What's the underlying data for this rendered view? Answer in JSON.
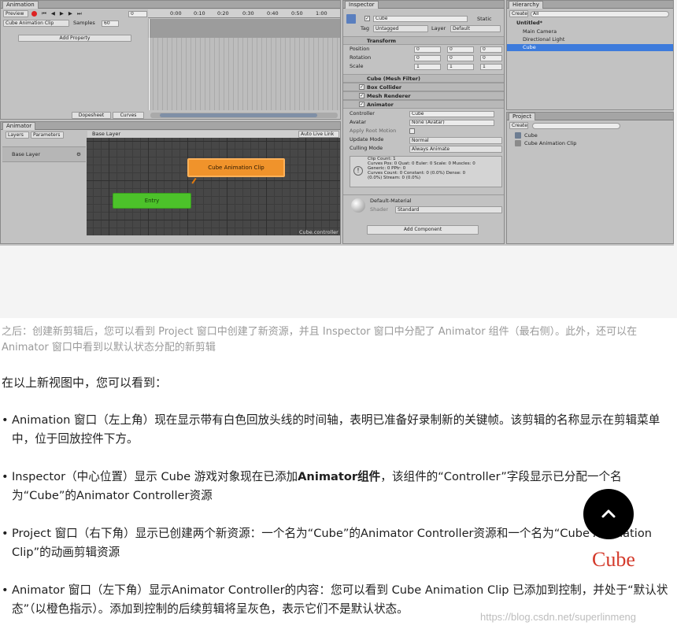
{
  "editor": {
    "animation": {
      "tab": "Animation",
      "preview": "Preview",
      "clip": "Cube Animation Clip",
      "samples_label": "Samples",
      "samples_value": "60",
      "frame_value": "0",
      "add_property": "Add Property",
      "times": [
        "0:00",
        "0:10",
        "0:20",
        "0:30",
        "0:40",
        "0:50",
        "1:00"
      ],
      "bottom_tabs": [
        "Dopesheet",
        "Curves"
      ]
    },
    "animator": {
      "tab": "Animator",
      "tabs": [
        "Layers",
        "Parameters"
      ],
      "layer": "Base Layer",
      "breadcrumb": "Base Layer",
      "auto_live": "Auto Live Link",
      "state_orange": "Cube Animation Clip",
      "state_green": "Entry",
      "footer": "Cube.controller"
    },
    "inspector": {
      "tab": "Inspector",
      "object_name": "Cube",
      "static": "Static",
      "tag_label": "Tag",
      "tag_value": "Untagged",
      "layer_label": "Layer",
      "layer_value": "Default",
      "transform": "Transform",
      "rows": [
        {
          "label": "Position",
          "x": "0",
          "y": "0",
          "z": "0"
        },
        {
          "label": "Rotation",
          "x": "0",
          "y": "0",
          "z": "0"
        },
        {
          "label": "Scale",
          "x": "1",
          "y": "1",
          "z": "1"
        }
      ],
      "components": [
        "Cube (Mesh Filter)",
        "Box Collider",
        "Mesh Renderer",
        "Animator"
      ],
      "animator_rows": [
        {
          "label": "Controller",
          "value": "Cube"
        },
        {
          "label": "Avatar",
          "value": "None (Avatar)"
        },
        {
          "label": "Apply Root Motion",
          "value": ""
        },
        {
          "label": "Update Mode",
          "value": "Normal"
        },
        {
          "label": "Culling Mode",
          "value": "Always Animate"
        }
      ],
      "info": [
        "Clip Count: 1",
        "Curves Pos: 0 Quat: 0 Euler: 0 Scale: 0 Muscles: 0",
        "Generic: 0 PPtr: 0",
        "Curves Count: 0 Constant: 0 (0.0%) Dense: 0",
        "(0.0%) Stream: 0 (0.0%)"
      ],
      "material": "Default-Material",
      "shader_label": "Shader",
      "shader_value": "Standard",
      "add_component": "Add Component"
    },
    "hierarchy": {
      "tab": "Hierarchy",
      "create": "Create",
      "search": "All",
      "scene": "Untitled*",
      "items": [
        "Main Camera",
        "Directional Light",
        "Cube"
      ]
    },
    "project": {
      "tab": "Project",
      "create": "Create",
      "items": [
        "Cube",
        "Cube Animation Clip"
      ]
    }
  },
  "caption": "之后：创建新剪辑后，您可以看到 Project 窗口中创建了新资源，并且 Inspector 窗口中分配了 Animator 组件（最右侧）。此外，还可以在 Animator 窗口中看到以默认状态分配的新剪辑",
  "intro": "在以上新视图中，您可以看到：",
  "bullets": [
    {
      "pre": "Animation 窗口（左上角）现在显示带有白色回放头线的时间轴，表明已准备好录制新的关键帧。该剪辑的名称显示在剪辑菜单中，位于回放控件下方。",
      "bold": "",
      "post": ""
    },
    {
      "pre": "Inspector（中心位置）显示 Cube 游戏对象现在已添加",
      "bold": "Animator组件",
      "post": "，该组件的“Controller”字段显示已分配一个名为“Cube”的Animator Controller资源"
    },
    {
      "pre": "Project 窗口（右下角）显示已创建两个新资源：一个名为“Cube”的Animator Controller资源和一个名为“Cube Animation Clip”的动画剪辑资源",
      "bold": "",
      "post": ""
    },
    {
      "pre": "Animator 窗口（左下角）显示Animator Controller的内容：您可以看到 Cube Animation Clip 已添加到控制，并处于“默认状态”（以橙色指示）。添加到控制的后续剪辑将呈灰色，表示它们不是默认状态。",
      "bold": "",
      "post": ""
    }
  ],
  "floating_label": "Cube",
  "watermark": "https://blog.csdn.net/superlinmeng",
  "colors": {
    "orange_state": "#f0932b",
    "green_state": "#4cc22a",
    "selection": "#3d7bdc",
    "fab": "#000000",
    "cube_red": "#d43a2b"
  },
  "icons": {
    "scroll_top": "chevron-up-icon"
  }
}
